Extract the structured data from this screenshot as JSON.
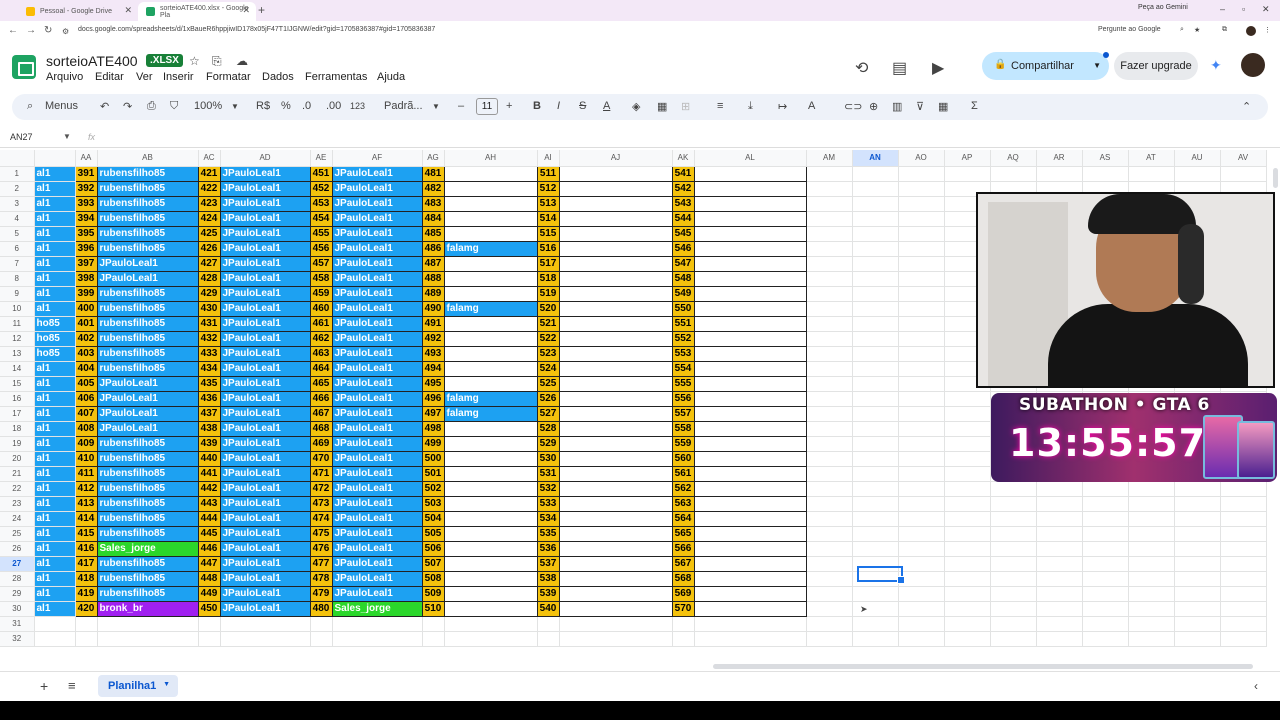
{
  "browser": {
    "tabs": [
      {
        "label": "Pessoal - Google Drive"
      },
      {
        "label": "sorteioATE400.xlsx - Google Pla"
      }
    ],
    "gemini_label": "Peça ao Gemini",
    "url": "docs.google.com/spreadsheets/d/1xBaueR6hppjiwID178x05jF47T1IJGNW/edit?gid=1705836387#gid=1705836387",
    "ask_google": "Pergunte ao Google"
  },
  "doc": {
    "title": "sorteioATE400",
    "badge": ".XLSX"
  },
  "menu": [
    "Arquivo",
    "Editar",
    "Ver",
    "Inserir",
    "Formatar",
    "Dados",
    "Ferramentas",
    "Ajuda"
  ],
  "header": {
    "share": "Compartilhar",
    "upgrade": "Fazer upgrade"
  },
  "toolbar": {
    "menus": "Menus",
    "zoom": "100%",
    "currency": "R$",
    "percent": "%",
    "dec_less": ".0",
    "dec_more": ".00",
    "numfmt": "123",
    "font": "Padrã...",
    "font_size": "11"
  },
  "formula": {
    "namebox": "AN27",
    "fx": "fx"
  },
  "columns": [
    "",
    "AA",
    "AB",
    "AC",
    "AD",
    "AE",
    "AF",
    "AG",
    "AH",
    "AI",
    "AJ",
    "AK",
    "AL",
    "AM",
    "AN",
    "AO",
    "AP",
    "AQ",
    "AR",
    "AS",
    "AT",
    "AU",
    "AV"
  ],
  "selected_col": "AN",
  "selected_row": 27,
  "rows": [
    {
      "n": 1,
      "z": "al1",
      "aa": "391",
      "ab": "rubensfilho85",
      "ac": "421",
      "ad": "JPauloLeal1",
      "ae": "451",
      "af": "JPauloLeal1",
      "ag": "481",
      "ah": "",
      "ai": "511",
      "ak": "541",
      "abc": "b"
    },
    {
      "n": 2,
      "z": "al1",
      "aa": "392",
      "ab": "rubensfilho85",
      "ac": "422",
      "ad": "JPauloLeal1",
      "ae": "452",
      "af": "JPauloLeal1",
      "ag": "482",
      "ah": "",
      "ai": "512",
      "ak": "542",
      "abc": "b"
    },
    {
      "n": 3,
      "z": "al1",
      "aa": "393",
      "ab": "rubensfilho85",
      "ac": "423",
      "ad": "JPauloLeal1",
      "ae": "453",
      "af": "JPauloLeal1",
      "ag": "483",
      "ah": "",
      "ai": "513",
      "ak": "543",
      "abc": "b"
    },
    {
      "n": 4,
      "z": "al1",
      "aa": "394",
      "ab": "rubensfilho85",
      "ac": "424",
      "ad": "JPauloLeal1",
      "ae": "454",
      "af": "JPauloLeal1",
      "ag": "484",
      "ah": "",
      "ai": "514",
      "ak": "544",
      "abc": "b"
    },
    {
      "n": 5,
      "z": "al1",
      "aa": "395",
      "ab": "rubensfilho85",
      "ac": "425",
      "ad": "JPauloLeal1",
      "ae": "455",
      "af": "JPauloLeal1",
      "ag": "485",
      "ah": "",
      "ai": "515",
      "ak": "545",
      "abc": "b"
    },
    {
      "n": 6,
      "z": "al1",
      "aa": "396",
      "ab": "rubensfilho85",
      "ac": "426",
      "ad": "JPauloLeal1",
      "ae": "456",
      "af": "JPauloLeal1",
      "ag": "486",
      "ah": "falamg",
      "ai": "516",
      "ak": "546",
      "abc": "b"
    },
    {
      "n": 7,
      "z": "al1",
      "aa": "397",
      "ab": "JPauloLeal1",
      "ac": "427",
      "ad": "JPauloLeal1",
      "ae": "457",
      "af": "JPauloLeal1",
      "ag": "487",
      "ah": "",
      "ai": "517",
      "ak": "547",
      "abc": "b"
    },
    {
      "n": 8,
      "z": "al1",
      "aa": "398",
      "ab": "JPauloLeal1",
      "ac": "428",
      "ad": "JPauloLeal1",
      "ae": "458",
      "af": "JPauloLeal1",
      "ag": "488",
      "ah": "",
      "ai": "518",
      "ak": "548",
      "abc": "b"
    },
    {
      "n": 9,
      "z": "al1",
      "aa": "399",
      "ab": "rubensfilho85",
      "ac": "429",
      "ad": "JPauloLeal1",
      "ae": "459",
      "af": "JPauloLeal1",
      "ag": "489",
      "ah": "",
      "ai": "519",
      "ak": "549",
      "abc": "b"
    },
    {
      "n": 10,
      "z": "al1",
      "aa": "400",
      "ab": "rubensfilho85",
      "ac": "430",
      "ad": "JPauloLeal1",
      "ae": "460",
      "af": "JPauloLeal1",
      "ag": "490",
      "ah": "falamg",
      "ai": "520",
      "ak": "550",
      "abc": "b"
    },
    {
      "n": 11,
      "z": "ho85",
      "aa": "401",
      "ab": "rubensfilho85",
      "ac": "431",
      "ad": "JPauloLeal1",
      "ae": "461",
      "af": "JPauloLeal1",
      "ag": "491",
      "ah": "",
      "ai": "521",
      "ak": "551",
      "abc": "b"
    },
    {
      "n": 12,
      "z": "ho85",
      "aa": "402",
      "ab": "rubensfilho85",
      "ac": "432",
      "ad": "JPauloLeal1",
      "ae": "462",
      "af": "JPauloLeal1",
      "ag": "492",
      "ah": "",
      "ai": "522",
      "ak": "552",
      "abc": "b"
    },
    {
      "n": 13,
      "z": "ho85",
      "aa": "403",
      "ab": "rubensfilho85",
      "ac": "433",
      "ad": "JPauloLeal1",
      "ae": "463",
      "af": "JPauloLeal1",
      "ag": "493",
      "ah": "",
      "ai": "523",
      "ak": "553",
      "abc": "b"
    },
    {
      "n": 14,
      "z": "al1",
      "aa": "404",
      "ab": "rubensfilho85",
      "ac": "434",
      "ad": "JPauloLeal1",
      "ae": "464",
      "af": "JPauloLeal1",
      "ag": "494",
      "ah": "",
      "ai": "524",
      "ak": "554",
      "abc": "b"
    },
    {
      "n": 15,
      "z": "al1",
      "aa": "405",
      "ab": "JPauloLeal1",
      "ac": "435",
      "ad": "JPauloLeal1",
      "ae": "465",
      "af": "JPauloLeal1",
      "ag": "495",
      "ah": "",
      "ai": "525",
      "ak": "555",
      "abc": "b"
    },
    {
      "n": 16,
      "z": "al1",
      "aa": "406",
      "ab": "JPauloLeal1",
      "ac": "436",
      "ad": "JPauloLeal1",
      "ae": "466",
      "af": "JPauloLeal1",
      "ag": "496",
      "ah": "falamg",
      "ai": "526",
      "ak": "556",
      "abc": "b"
    },
    {
      "n": 17,
      "z": "al1",
      "aa": "407",
      "ab": "JPauloLeal1",
      "ac": "437",
      "ad": "JPauloLeal1",
      "ae": "467",
      "af": "JPauloLeal1",
      "ag": "497",
      "ah": "falamg",
      "ai": "527",
      "ak": "557",
      "abc": "b"
    },
    {
      "n": 18,
      "z": "al1",
      "aa": "408",
      "ab": "JPauloLeal1",
      "ac": "438",
      "ad": "JPauloLeal1",
      "ae": "468",
      "af": "JPauloLeal1",
      "ag": "498",
      "ah": "",
      "ai": "528",
      "ak": "558",
      "abc": "b"
    },
    {
      "n": 19,
      "z": "al1",
      "aa": "409",
      "ab": "rubensfilho85",
      "ac": "439",
      "ad": "JPauloLeal1",
      "ae": "469",
      "af": "JPauloLeal1",
      "ag": "499",
      "ah": "",
      "ai": "529",
      "ak": "559",
      "abc": "b"
    },
    {
      "n": 20,
      "z": "al1",
      "aa": "410",
      "ab": "rubensfilho85",
      "ac": "440",
      "ad": "JPauloLeal1",
      "ae": "470",
      "af": "JPauloLeal1",
      "ag": "500",
      "ah": "",
      "ai": "530",
      "ak": "560",
      "abc": "b"
    },
    {
      "n": 21,
      "z": "al1",
      "aa": "411",
      "ab": "rubensfilho85",
      "ac": "441",
      "ad": "JPauloLeal1",
      "ae": "471",
      "af": "JPauloLeal1",
      "ag": "501",
      "ah": "",
      "ai": "531",
      "ak": "561",
      "abc": "b"
    },
    {
      "n": 22,
      "z": "al1",
      "aa": "412",
      "ab": "rubensfilho85",
      "ac": "442",
      "ad": "JPauloLeal1",
      "ae": "472",
      "af": "JPauloLeal1",
      "ag": "502",
      "ah": "",
      "ai": "532",
      "ak": "562",
      "abc": "b"
    },
    {
      "n": 23,
      "z": "al1",
      "aa": "413",
      "ab": "rubensfilho85",
      "ac": "443",
      "ad": "JPauloLeal1",
      "ae": "473",
      "af": "JPauloLeal1",
      "ag": "503",
      "ah": "",
      "ai": "533",
      "ak": "563",
      "abc": "b"
    },
    {
      "n": 24,
      "z": "al1",
      "aa": "414",
      "ab": "rubensfilho85",
      "ac": "444",
      "ad": "JPauloLeal1",
      "ae": "474",
      "af": "JPauloLeal1",
      "ag": "504",
      "ah": "",
      "ai": "534",
      "ak": "564",
      "abc": "b"
    },
    {
      "n": 25,
      "z": "al1",
      "aa": "415",
      "ab": "rubensfilho85",
      "ac": "445",
      "ad": "JPauloLeal1",
      "ae": "475",
      "af": "JPauloLeal1",
      "ag": "505",
      "ah": "",
      "ai": "535",
      "ak": "565",
      "abc": "b"
    },
    {
      "n": 26,
      "z": "al1",
      "aa": "416",
      "ab": "Sales_jorge",
      "ac": "446",
      "ad": "JPauloLeal1",
      "ae": "476",
      "af": "JPauloLeal1",
      "ag": "506",
      "ah": "",
      "ai": "536",
      "ak": "566",
      "abc": "g"
    },
    {
      "n": 27,
      "z": "al1",
      "aa": "417",
      "ab": "rubensfilho85",
      "ac": "447",
      "ad": "JPauloLeal1",
      "ae": "477",
      "af": "JPauloLeal1",
      "ag": "507",
      "ah": "",
      "ai": "537",
      "ak": "567",
      "abc": "b"
    },
    {
      "n": 28,
      "z": "al1",
      "aa": "418",
      "ab": "rubensfilho85",
      "ac": "448",
      "ad": "JPauloLeal1",
      "ae": "478",
      "af": "JPauloLeal1",
      "ag": "508",
      "ah": "",
      "ai": "538",
      "ak": "568",
      "abc": "b"
    },
    {
      "n": 29,
      "z": "al1",
      "aa": "419",
      "ab": "rubensfilho85",
      "ac": "449",
      "ad": "JPauloLeal1",
      "ae": "479",
      "af": "JPauloLeal1",
      "ag": "509",
      "ah": "",
      "ai": "539",
      "ak": "569",
      "abc": "b"
    },
    {
      "n": 30,
      "z": "al1",
      "aa": "420",
      "ab": "bronk_br",
      "ac": "450",
      "ad": "JPauloLeal1",
      "ae": "480",
      "af": "Sales_jorge",
      "ag": "510",
      "ah": "",
      "ai": "540",
      "ak": "570",
      "abc": "p",
      "afc": "g"
    }
  ],
  "extra_rows": [
    31,
    32
  ],
  "sheet": {
    "name": "Planilha1"
  },
  "overlay": {
    "banner_title": "SUBATHON • GTA 6",
    "timer": "13:55:57"
  },
  "colors": {
    "blue": "#1da1f2",
    "yellow": "#f4c20d",
    "green": "#2bd72b",
    "purple": "#a020f0",
    "accent": "#1a73e8"
  }
}
